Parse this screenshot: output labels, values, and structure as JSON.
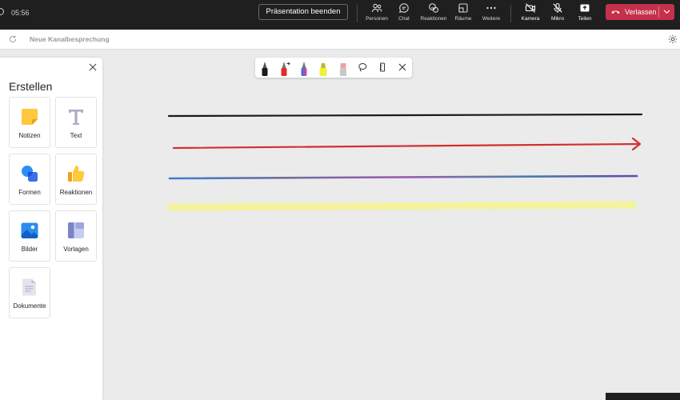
{
  "meeting": {
    "timer": "05:56",
    "stop_presenting": "Präsentation beenden",
    "tools": [
      {
        "label": "Personen",
        "icon": "people-icon"
      },
      {
        "label": "Chat",
        "icon": "chat-icon"
      },
      {
        "label": "Reaktionen",
        "icon": "reactions-icon"
      },
      {
        "label": "Räume",
        "icon": "rooms-icon"
      },
      {
        "label": "Weitere",
        "icon": "more-icon"
      },
      {
        "label": "Kamera",
        "icon": "camera-off-icon"
      },
      {
        "label": "Mikro",
        "icon": "mic-off-icon"
      },
      {
        "label": "Teilen",
        "icon": "share-icon"
      }
    ],
    "leave": "Verlassen"
  },
  "subbar": {
    "title": "Neue Kanalbesprechung"
  },
  "create_panel": {
    "title": "Erstellen",
    "items": [
      {
        "label": "Notizen",
        "icon": "sticky-note-icon"
      },
      {
        "label": "Text",
        "icon": "text-icon"
      },
      {
        "label": "Formen",
        "icon": "shapes-icon"
      },
      {
        "label": "Reaktionen",
        "icon": "thumbs-up-icon"
      },
      {
        "label": "Bilder",
        "icon": "image-icon"
      },
      {
        "label": "Vorlagen",
        "icon": "templates-icon"
      },
      {
        "label": "Dokumente",
        "icon": "document-icon"
      }
    ]
  },
  "whiteboard_toolbar": {
    "tools": [
      "black-pen-icon",
      "red-arrow-pen-icon",
      "rainbow-pen-icon",
      "highlighter-icon",
      "eraser-icon",
      "lasso-icon",
      "ruler-icon",
      "close-icon"
    ]
  },
  "colors": {
    "topbar": "#1f1f1f",
    "leave_button": "#c4314b",
    "stroke_black": "#1a1a1a",
    "stroke_red": "#d32f2f",
    "stroke_highlighter": "#f4f49a",
    "canvas": "#ebebeb"
  }
}
